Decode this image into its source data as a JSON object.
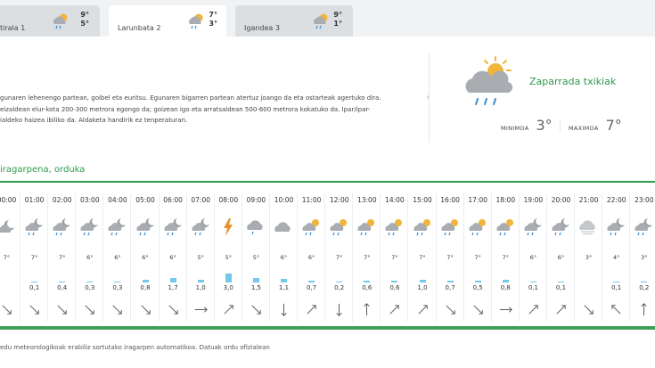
{
  "tabs": [
    {
      "day": "tirala 1",
      "hi": "9°",
      "lo": "5°",
      "icon": "cloud-sun-rain-icon",
      "active": false
    },
    {
      "day": "Larunbata 2",
      "hi": "7°",
      "lo": "3°",
      "icon": "cloud-sun-rain-icon",
      "active": true
    },
    {
      "day": "Igandea 3",
      "hi": "9°",
      "lo": "1°",
      "icon": "cloud-sun-rain-icon",
      "active": false
    }
  ],
  "description": {
    "line1": "gunaren lehenengo partean, goibel eta euritsu. Egunaren bigarren partean atertuz joango da eta ostarteak agertuko dira.",
    "line2": "eizaldean elur-kota 200-300 metrora egongo da; goizean igo eta arratsaldean 500-600 metrora kokatuko da. Ipar/ipar-",
    "line3": "ialdeko haizea ibiliko da. Aldaketa handirik ez tenperaturan."
  },
  "summary": {
    "condition": "Zaparrada txikiak",
    "min_label": "MINIMOA",
    "min_value": "3°",
    "max_label": "MAXIMOA",
    "max_value": "7°"
  },
  "hourly": {
    "title": "iragarpena, orduka",
    "hours": [
      {
        "time": "00:00",
        "icon": "moon-cloud",
        "temp": "7°",
        "precip": "",
        "wind": "se"
      },
      {
        "time": "01:00",
        "icon": "moon-cloud-rain",
        "temp": "7°",
        "precip": "0,1",
        "wind": "se"
      },
      {
        "time": "02:00",
        "icon": "moon-cloud-rain",
        "temp": "7°",
        "precip": "0,4",
        "wind": "se"
      },
      {
        "time": "03:00",
        "icon": "moon-cloud-rain",
        "temp": "6°",
        "precip": "0,3",
        "wind": "se"
      },
      {
        "time": "04:00",
        "icon": "moon-cloud-rain",
        "temp": "6°",
        "precip": "0,3",
        "wind": "se"
      },
      {
        "time": "05:00",
        "icon": "moon-cloud-rain",
        "temp": "6°",
        "precip": "0,8",
        "wind": "se"
      },
      {
        "time": "06:00",
        "icon": "moon-cloud-rain",
        "temp": "6°",
        "precip": "1,7",
        "wind": "se"
      },
      {
        "time": "07:00",
        "icon": "moon-cloud-rain",
        "temp": "5°",
        "precip": "1,0",
        "wind": "e"
      },
      {
        "time": "08:00",
        "icon": "lightning",
        "temp": "5°",
        "precip": "3,0",
        "wind": "ne"
      },
      {
        "time": "09:00",
        "icon": "cloud-rain",
        "temp": "5°",
        "precip": "1,5",
        "wind": "se"
      },
      {
        "time": "10:00",
        "icon": "cloud",
        "temp": "6°",
        "precip": "1,1",
        "wind": "s"
      },
      {
        "time": "11:00",
        "icon": "sun-cloud-rain",
        "temp": "6°",
        "precip": "0,7",
        "wind": "ne"
      },
      {
        "time": "12:00",
        "icon": "sun-cloud-rain",
        "temp": "7°",
        "precip": "0,2",
        "wind": "s"
      },
      {
        "time": "13:00",
        "icon": "sun-cloud-rain",
        "temp": "7°",
        "precip": "0,6",
        "wind": "n"
      },
      {
        "time": "14:00",
        "icon": "sun-cloud-rain",
        "temp": "7°",
        "precip": "0,6",
        "wind": "ne"
      },
      {
        "time": "15:00",
        "icon": "sun-cloud-rain",
        "temp": "7°",
        "precip": "1,0",
        "wind": "ne"
      },
      {
        "time": "16:00",
        "icon": "sun-cloud-rain",
        "temp": "7°",
        "precip": "0,7",
        "wind": "se"
      },
      {
        "time": "17:00",
        "icon": "sun-cloud-rain",
        "temp": "7°",
        "precip": "0,5",
        "wind": "se"
      },
      {
        "time": "18:00",
        "icon": "sun-cloud-rain",
        "temp": "7°",
        "precip": "0,8",
        "wind": "e"
      },
      {
        "time": "19:00",
        "icon": "moon-cloud-rain",
        "temp": "6°",
        "precip": "0,1",
        "wind": "ne"
      },
      {
        "time": "20:00",
        "icon": "moon-cloud-rain",
        "temp": "6°",
        "precip": "0,1",
        "wind": "ne"
      },
      {
        "time": "21:00",
        "icon": "cloud-fog",
        "temp": "3°",
        "precip": "",
        "wind": "se"
      },
      {
        "time": "22:00",
        "icon": "moon-cloud-rain",
        "temp": "4°",
        "precip": "0,1",
        "wind": "nw"
      },
      {
        "time": "23:00",
        "icon": "moon-cloud-rain",
        "temp": "3°",
        "precip": "0,2",
        "wind": "n"
      }
    ]
  },
  "footer": "edu meteorologikoak erabiliz sortutako iragarpen automatikoa. Datuak ordu ofizialean",
  "colors": {
    "accent_green": "#2e9a4a",
    "precip_bar": "#72c8e8",
    "sun": "#f2b53a",
    "cloud": "#a9adb2",
    "rain": "#3c8fd1",
    "lightning": "#e8912d"
  }
}
